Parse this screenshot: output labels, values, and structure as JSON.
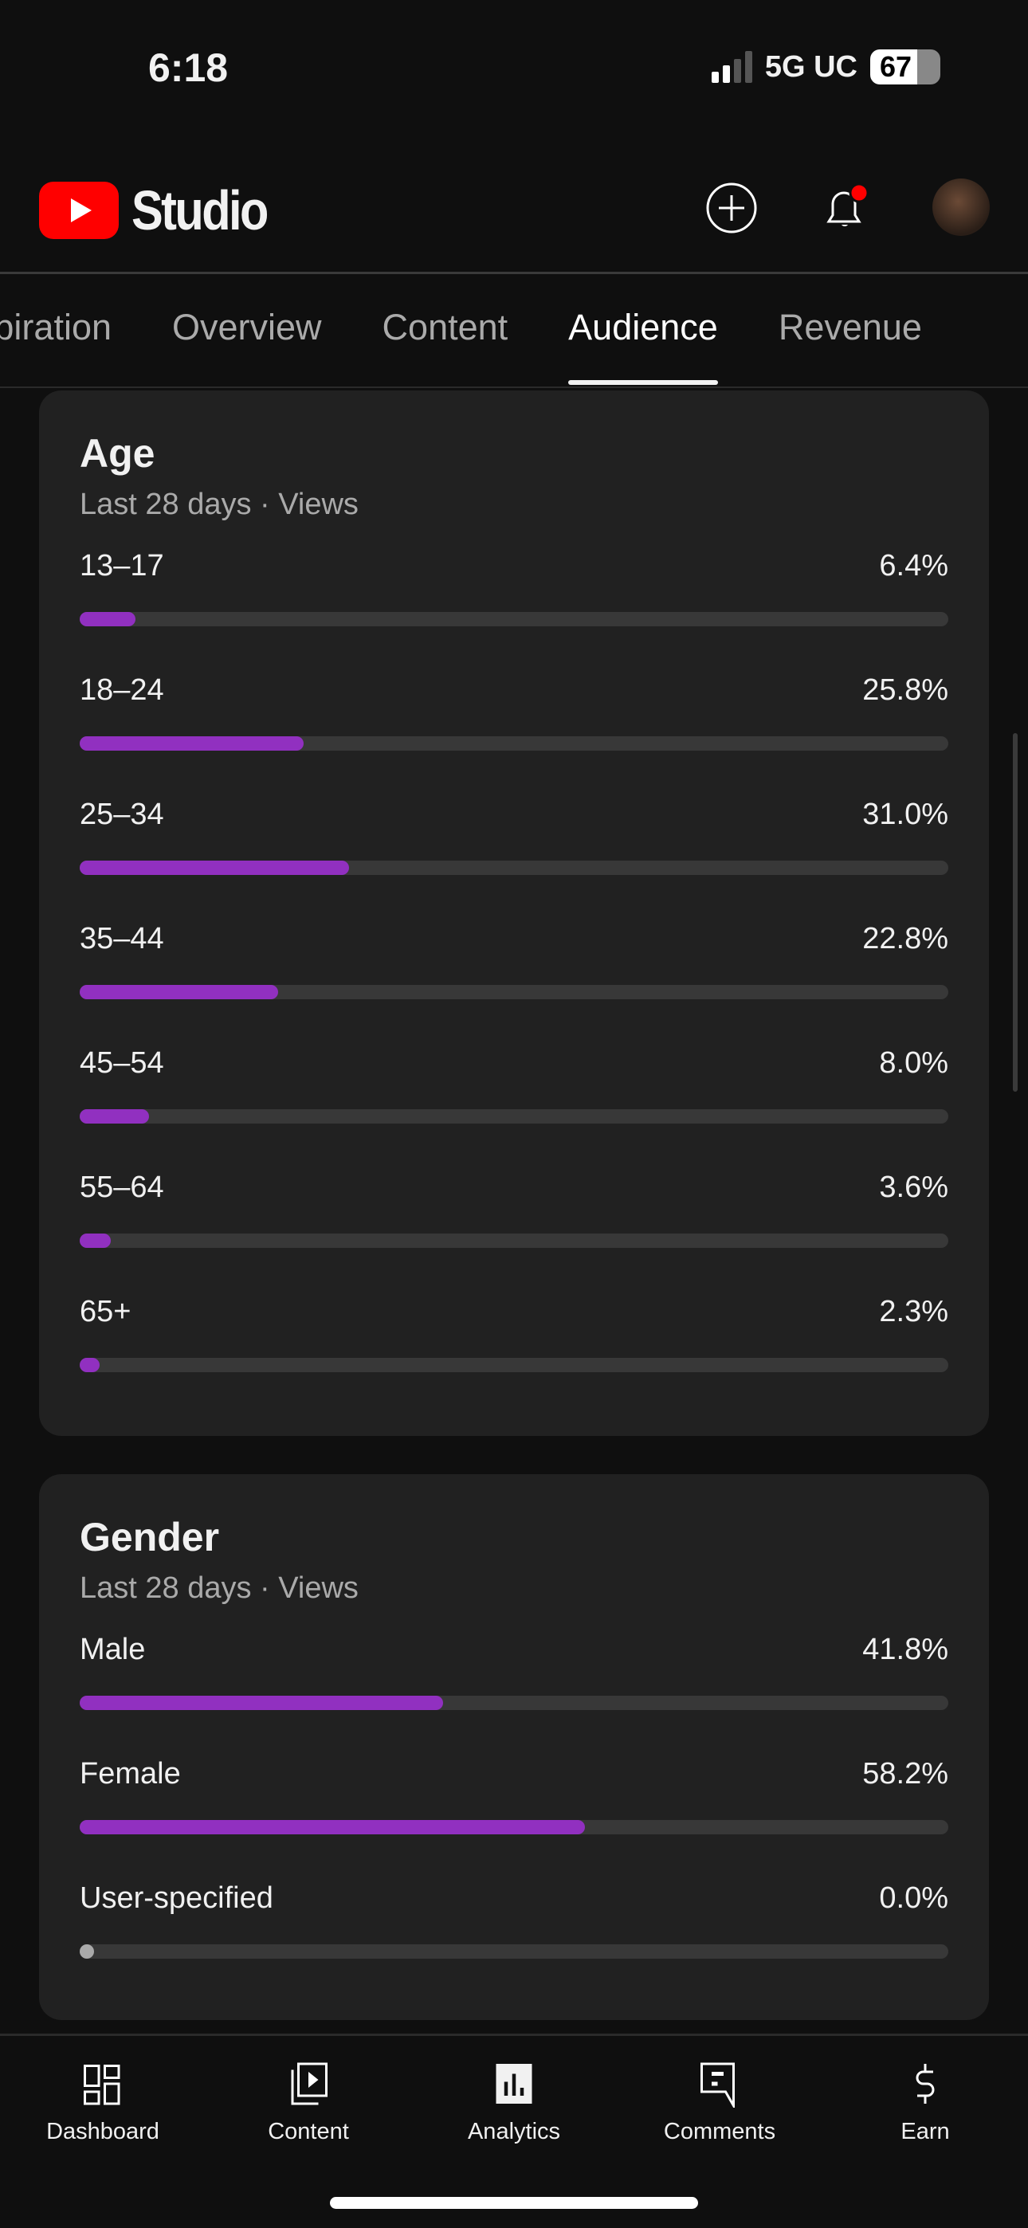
{
  "status": {
    "time": "6:18",
    "network": "5G UC",
    "battery": "67"
  },
  "header": {
    "app_name": "Studio",
    "icons": [
      "create-icon",
      "bell-icon",
      "avatar"
    ],
    "notification_color": "#ff0000"
  },
  "tabs": [
    {
      "label": "Inspiration"
    },
    {
      "label": "Overview"
    },
    {
      "label": "Content"
    },
    {
      "label": "Audience",
      "active": true
    },
    {
      "label": "Revenue"
    }
  ],
  "age": {
    "title": "Age",
    "subtitle": "Last 28 days · Views",
    "rows": [
      {
        "label": "13–17",
        "value": "6.4%",
        "pct": 6.4
      },
      {
        "label": "18–24",
        "value": "25.8%",
        "pct": 25.8
      },
      {
        "label": "25–34",
        "value": "31.0%",
        "pct": 31.0
      },
      {
        "label": "35–44",
        "value": "22.8%",
        "pct": 22.8
      },
      {
        "label": "45–54",
        "value": "8.0%",
        "pct": 8.0
      },
      {
        "label": "55–64",
        "value": "3.6%",
        "pct": 3.6
      },
      {
        "label": "65+",
        "value": "2.3%",
        "pct": 2.3
      }
    ]
  },
  "gender": {
    "title": "Gender",
    "subtitle": "Last 28 days · Views",
    "rows": [
      {
        "label": "Male",
        "value": "41.8%",
        "pct": 41.8
      },
      {
        "label": "Female",
        "value": "58.2%",
        "pct": 58.2
      },
      {
        "label": "User-specified",
        "value": "0.0%",
        "pct": 0.0
      }
    ]
  },
  "colors": {
    "bar": "#9130c0",
    "track": "#383838",
    "card": "#212121",
    "background": "#0f0f0f"
  },
  "nav": [
    {
      "label": "Dashboard",
      "icon": "dashboard-icon"
    },
    {
      "label": "Content",
      "icon": "content-icon"
    },
    {
      "label": "Analytics",
      "icon": "analytics-icon",
      "active": true
    },
    {
      "label": "Comments",
      "icon": "comments-icon"
    },
    {
      "label": "Earn",
      "icon": "dollar-icon"
    }
  ]
}
